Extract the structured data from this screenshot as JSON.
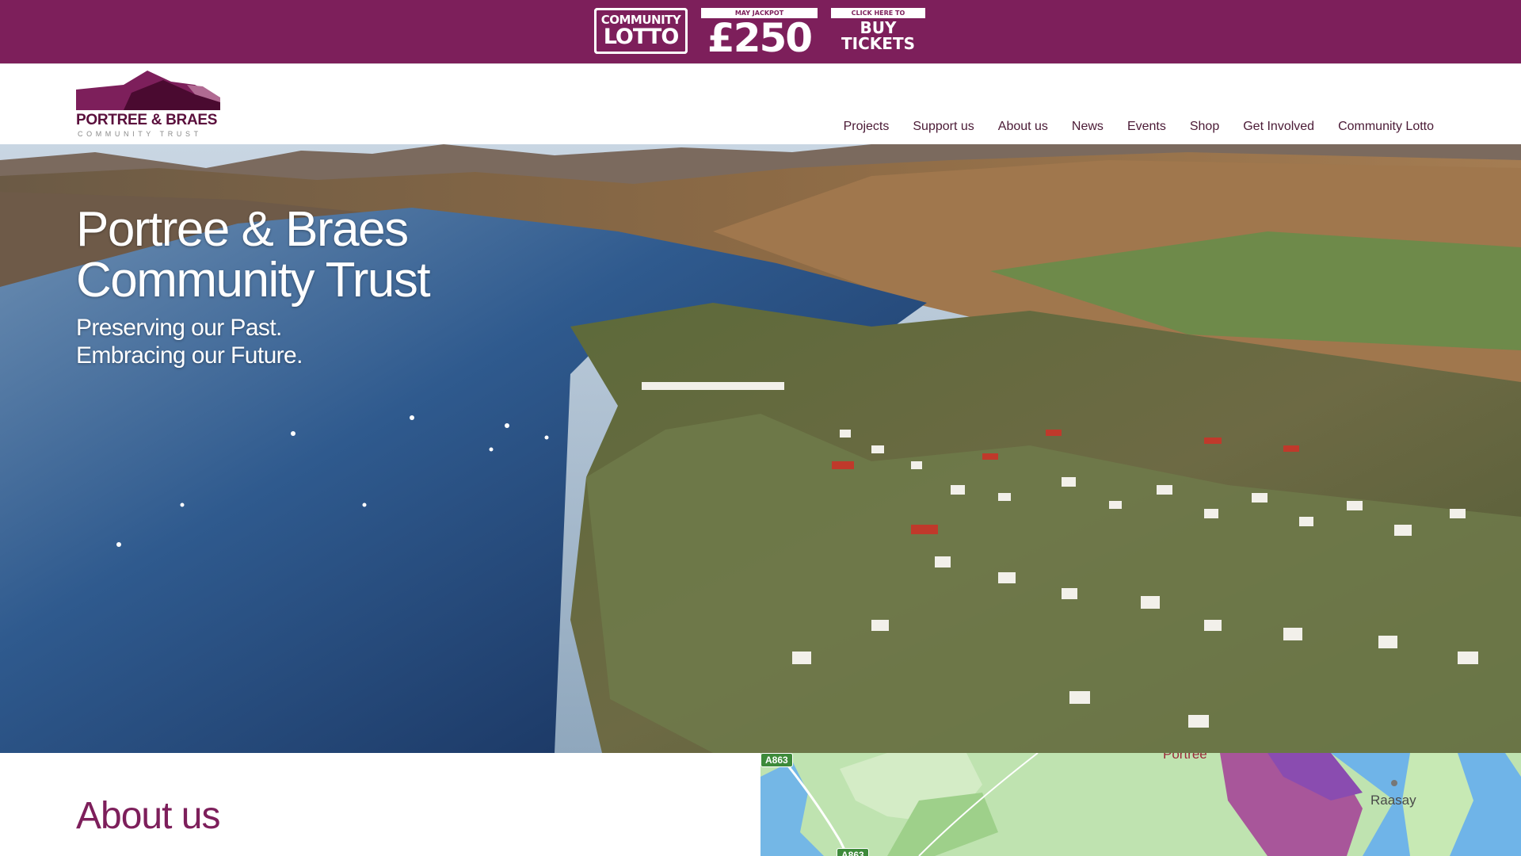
{
  "banner": {
    "lotto_logo_top": "COMMUNITY",
    "lotto_logo_bottom": "LOTTO",
    "jackpot_tag": "MAY JACKPOT",
    "jackpot_amount": "£250",
    "buy_tag": "CLICK HERE TO",
    "buy_line1": "BUY",
    "buy_line2": "TICKETS",
    "background_color": "#7d1f5b"
  },
  "logo": {
    "name": "PORTREE & BRAES",
    "subtitle": "COMMUNITY TRUST"
  },
  "nav": {
    "items": [
      "Projects",
      "Support us",
      "About us",
      "News",
      "Events",
      "Shop",
      "Get Involved",
      "Community Lotto"
    ]
  },
  "hero": {
    "title_line1": "Portree & Braes",
    "title_line2": "Community Trust",
    "subtitle_line1": "Preserving our Past.",
    "subtitle_line2": "Embracing our Future."
  },
  "about": {
    "heading": "About us",
    "heading_color": "#7d1f5b"
  },
  "map": {
    "road1": "A863",
    "road2": "A863",
    "place_portree": "Portree",
    "place_raasay": "Raasay"
  }
}
